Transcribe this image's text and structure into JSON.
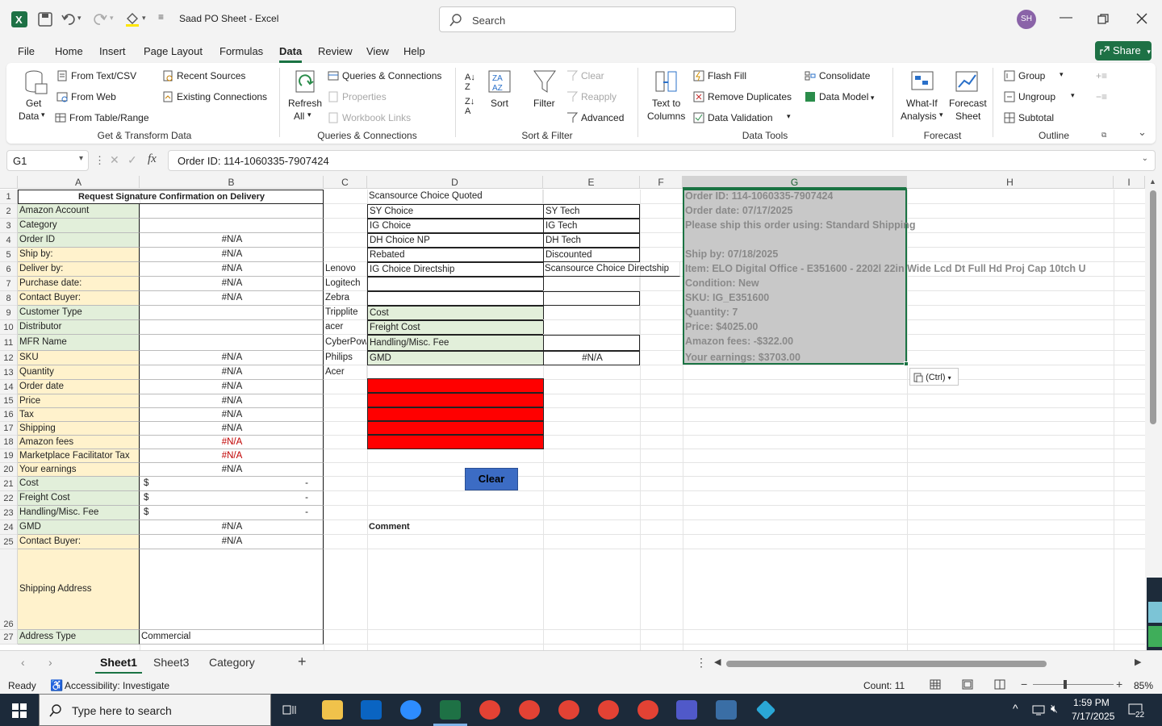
{
  "window": {
    "title": "Saad PO Sheet  -  Excel",
    "search_placeholder": "Search",
    "user_initials": "SH"
  },
  "menu": {
    "tabs": [
      "File",
      "Home",
      "Insert",
      "Page Layout",
      "Formulas",
      "Data",
      "Review",
      "View",
      "Help"
    ],
    "active": "Data",
    "share_label": "Share"
  },
  "ribbon": {
    "get_data": {
      "line1": "Get",
      "line2": "Data"
    },
    "from_text_csv": "From Text/CSV",
    "from_web": "From Web",
    "from_table": "From Table/Range",
    "recent_sources": "Recent Sources",
    "existing_connections": "Existing Connections",
    "group_get_transform": "Get & Transform Data",
    "refresh_all": {
      "line1": "Refresh",
      "line2": "All"
    },
    "queries_connections": "Queries & Connections",
    "properties": "Properties",
    "workbook_links": "Workbook Links",
    "group_queries": "Queries & Connections",
    "sort": "Sort",
    "filter": "Filter",
    "clear": "Clear",
    "reapply": "Reapply",
    "advanced": "Advanced",
    "group_sort_filter": "Sort & Filter",
    "text_to_columns": {
      "line1": "Text to",
      "line2": "Columns"
    },
    "flash_fill": "Flash Fill",
    "remove_duplicates": "Remove Duplicates",
    "data_validation": "Data Validation",
    "consolidate": "Consolidate",
    "data_model": "Data Model",
    "group_data_tools": "Data Tools",
    "what_if": {
      "line1": "What-If",
      "line2": "Analysis"
    },
    "forecast_sheet": {
      "line1": "Forecast",
      "line2": "Sheet"
    },
    "group_forecast": "Forecast",
    "group_btn": "Group",
    "ungroup_btn": "Ungroup",
    "subtotal_btn": "Subtotal",
    "group_outline": "Outline"
  },
  "formula_bar": {
    "name_box": "G1",
    "fx": "fx",
    "formula": "Order ID: 114-1060335-7907424"
  },
  "columns": [
    "A",
    "B",
    "C",
    "D",
    "E",
    "F",
    "G",
    "H",
    "I"
  ],
  "rows": [
    "1",
    "2",
    "3",
    "4",
    "5",
    "6",
    "7",
    "8",
    "9",
    "10",
    "11",
    "12",
    "13",
    "14",
    "15",
    "16",
    "17",
    "18",
    "19",
    "20",
    "21",
    "22",
    "23",
    "24",
    "25",
    "26",
    "27"
  ],
  "colA": {
    "r1": "Request Signature Confirmation on Delivery",
    "r2": "Amazon Account",
    "r3": "Category",
    "r4": "Order ID",
    "r5": "Ship by:",
    "r6": "Deliver by:",
    "r7": "Purchase date:",
    "r8": "Contact Buyer:",
    "r9": "Customer Type",
    "r10": "Distributor",
    "r11": "MFR Name",
    "r12": "SKU",
    "r13": "Quantity",
    "r14": "Order date",
    "r15": "Price",
    "r16": "Tax",
    "r17": "Shipping",
    "r18": "Amazon fees",
    "r19": "Marketplace Facilitator Tax",
    "r20": "Your earnings",
    "r21": "Cost",
    "r22": "Freight Cost",
    "r23": "Handling/Misc. Fee",
    "r24": "GMD",
    "r25": "Contact Buyer:",
    "r26": "Shipping Address",
    "r27": "Address Type"
  },
  "colB": {
    "na": "#N/A",
    "dollar": "$",
    "dash": "-",
    "r27": "Commercial"
  },
  "colC": [
    "Lenovo",
    "Logitech",
    "Zebra",
    "Tripplite",
    "acer",
    "CyberPow",
    "Philips",
    "Acer"
  ],
  "colD": {
    "r1": "Scansource Choice Quoted",
    "r2": "SY Choice",
    "r3": "IG Choice",
    "r4": "DH Choice NP",
    "r5": " Rebated",
    "r6": "IG Choice Directship",
    "r9": "Cost",
    "r10": "Freight Cost",
    "r11": "Handling/Misc. Fee",
    "r12": "GMD",
    "comment": "Comment"
  },
  "colE": {
    "r2": "SY Tech",
    "r3": "IG Tech",
    "r4": "DH Tech",
    "r5": " Discounted",
    "r6": "Scansource Choice Directship",
    "r12": "#N/A"
  },
  "colG": [
    "Order ID: 114-1060335-7907424",
    "Order date: 07/17/2025",
    "Please ship this order using: Standard Shipping",
    "",
    "Ship by: 07/18/2025",
    "Item: ELO Digital Office - E351600 - 2202l 22in Wide Lcd Dt Full Hd Proj Cap 10tch U",
    "Condition: New",
    "SKU: IG_E351600",
    "Quantity: 7",
    "Price: $4025.00",
    "Amazon fees: -$322.00",
    "Your earnings: $3703.00"
  ],
  "clear_button": "Clear",
  "paste_ctrl": "(Ctrl)",
  "sheets": [
    "Sheet1",
    "Sheet3",
    "Category"
  ],
  "active_sheet": "Sheet1",
  "status": {
    "ready": "Ready",
    "accessibility": "Accessibility: Investigate",
    "count": "Count: 11",
    "zoom": "85%"
  },
  "taskbar": {
    "search_placeholder": "Type here to search",
    "time": "1:59 PM",
    "date": "7/17/2025",
    "notifications": "22"
  },
  "colors": {
    "excel_green": "#1a7343",
    "label_green": "#e2efda",
    "label_yellow": "#fff2cc",
    "red_block": "#ff0000",
    "clear_button": "#3c6cc4"
  }
}
